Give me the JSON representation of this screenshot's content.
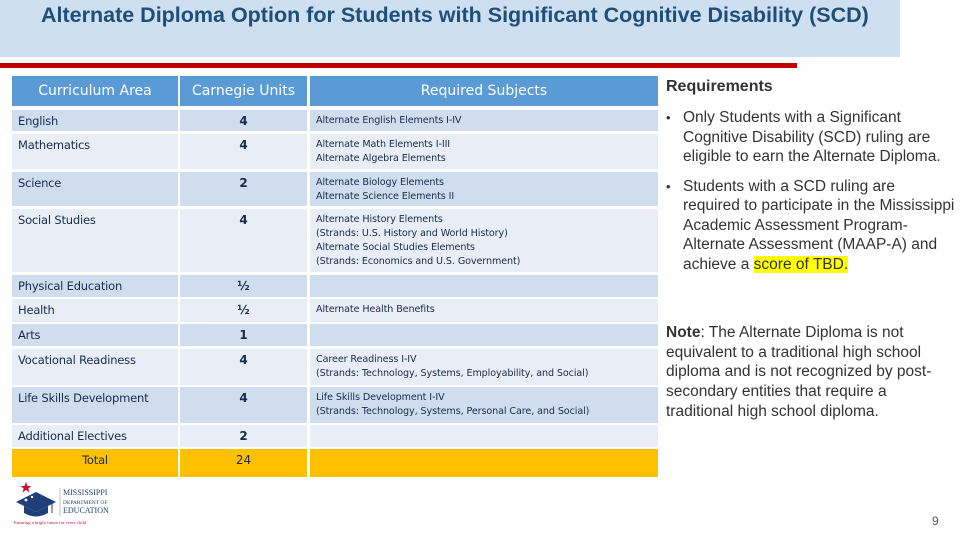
{
  "title": "Alternate Diploma Option for Students with Significant Cognitive Disability (SCD)",
  "colors": {
    "title_bg": "#cddff0",
    "title_text": "#1f4e79",
    "rule": "#c00000",
    "header_bg": "#5b9bd5",
    "row_dark": "#d0ddee",
    "row_light": "#e9eef6",
    "total_bg": "#ffc000",
    "highlight": "#ffff00"
  },
  "table": {
    "headers": [
      "Curriculum Area",
      "Carnegie Units",
      "Required Subjects"
    ],
    "rows": [
      {
        "area": "English",
        "units": "4",
        "subjects": "Alternate English Elements I-IV"
      },
      {
        "area": "Mathematics",
        "units": "4",
        "subjects": "Alternate Math Elements I-III\nAlternate Algebra Elements"
      },
      {
        "area": "Science",
        "units": "2",
        "subjects": "Alternate Biology Elements\nAlternate Science Elements II"
      },
      {
        "area": "Social Studies",
        "units": "4",
        "subjects": "Alternate History Elements\n(Strands: U.S. History and World History)\nAlternate Social Studies Elements\n(Strands: Economics and U.S. Government)"
      },
      {
        "area": "Physical Education",
        "units": "½",
        "subjects": ""
      },
      {
        "area": "Health",
        "units": "½",
        "subjects": "Alternate Health Benefits"
      },
      {
        "area": "Arts",
        "units": "1",
        "subjects": ""
      },
      {
        "area": "Vocational Readiness",
        "units": "4",
        "subjects": "Career Readiness I-IV\n(Strands: Technology, Systems, Employability, and Social)"
      },
      {
        "area": "Life Skills Development",
        "units": "4",
        "subjects": "Life Skills Development I-IV\n(Strands: Technology, Systems, Personal Care, and Social)"
      },
      {
        "area": "Additional Electives",
        "units": "2",
        "subjects": ""
      }
    ],
    "total": {
      "label": "Total",
      "units": "24",
      "subjects": ""
    }
  },
  "requirements": {
    "heading": "Requirements",
    "bullets": [
      {
        "text": "Only Students with a Significant Cognitive Disability (SCD) ruling are eligible to earn the Alternate Diploma.",
        "highlight": ""
      },
      {
        "text": "Students with a SCD ruling are required to participate in the Mississippi Academic Assessment Program-Alternate Assessment (MAAP-A) and achieve a ",
        "highlight": "score of TBD."
      }
    ],
    "bullet_icon": "bullet-dot",
    "note_label": "Note",
    "note_text": ": The Alternate Diploma is not equivalent to a traditional  high school diploma and is not recognized by post-secondary entities that require a traditional high school diploma."
  },
  "logo": {
    "line1": "MISSISSIPPI",
    "line2": "DEPARTMENT OF",
    "line3": "EDUCATION",
    "tagline": "Ensuring a bright future for every child",
    "icon": "graduation-cap-star-icon"
  },
  "page_number": "9"
}
